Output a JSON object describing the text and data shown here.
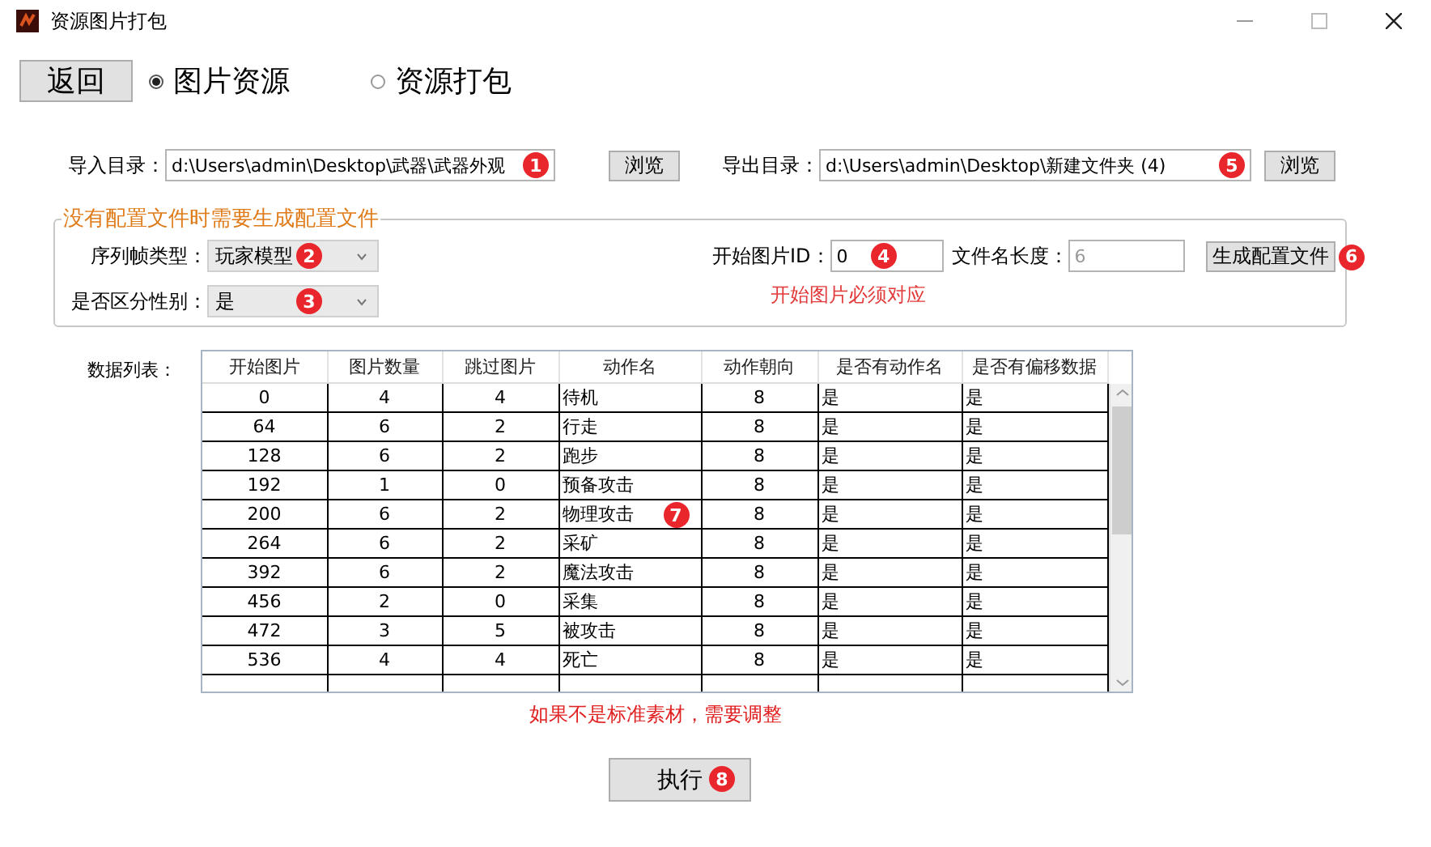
{
  "window": {
    "title": "资源图片打包"
  },
  "back_button": "返回",
  "modes": [
    {
      "label": "图片资源",
      "selected": true
    },
    {
      "label": "资源打包",
      "selected": false
    }
  ],
  "import": {
    "label": "导入目录：",
    "value": "d:\\Users\\admin\\Desktop\\武器\\武器外观",
    "badge": "1",
    "browse": "浏览"
  },
  "export": {
    "label": "导出目录：",
    "value": "d:\\Users\\admin\\Desktop\\新建文件夹 (4)",
    "badge": "5",
    "browse": "浏览"
  },
  "config_group": {
    "title": "没有配置文件时需要生成配置文件",
    "sequence_type": {
      "label": "序列帧类型：",
      "value": "玩家模型",
      "badge": "2"
    },
    "gender": {
      "label": "是否区分性别：",
      "value": "是",
      "badge": "3"
    },
    "start_id": {
      "label": "开始图片ID：",
      "value": "0",
      "badge": "4"
    },
    "name_length": {
      "label": "文件名长度：",
      "value": "6",
      "disabled": true
    },
    "generate_button": {
      "label": "生成配置文件",
      "badge": "6"
    },
    "hint": "开始图片必须对应"
  },
  "data_list": {
    "label": "数据列表：",
    "columns": [
      "开始图片",
      "图片数量",
      "跳过图片",
      "动作名",
      "动作朝向",
      "是否有动作名",
      "是否有偏移数据"
    ],
    "rows": [
      [
        "0",
        "4",
        "4",
        "待机",
        "8",
        "是",
        "是"
      ],
      [
        "64",
        "6",
        "2",
        "行走",
        "8",
        "是",
        "是"
      ],
      [
        "128",
        "6",
        "2",
        "跑步",
        "8",
        "是",
        "是"
      ],
      [
        "192",
        "1",
        "0",
        "预备攻击",
        "8",
        "是",
        "是"
      ],
      {
        "cells": [
          "200",
          "6",
          "2",
          "物理攻击",
          "8",
          "是",
          "是"
        ],
        "badge": "7"
      },
      [
        "264",
        "6",
        "2",
        "采矿",
        "8",
        "是",
        "是"
      ],
      [
        "392",
        "6",
        "2",
        "魔法攻击",
        "8",
        "是",
        "是"
      ],
      [
        "456",
        "2",
        "0",
        "采集",
        "8",
        "是",
        "是"
      ],
      [
        "472",
        "3",
        "5",
        "被攻击",
        "8",
        "是",
        "是"
      ],
      [
        "536",
        "4",
        "4",
        "死亡",
        "8",
        "是",
        "是"
      ]
    ]
  },
  "note": "如果不是标准素材，需要调整",
  "run_button": {
    "label": "执行",
    "badge": "8"
  }
}
